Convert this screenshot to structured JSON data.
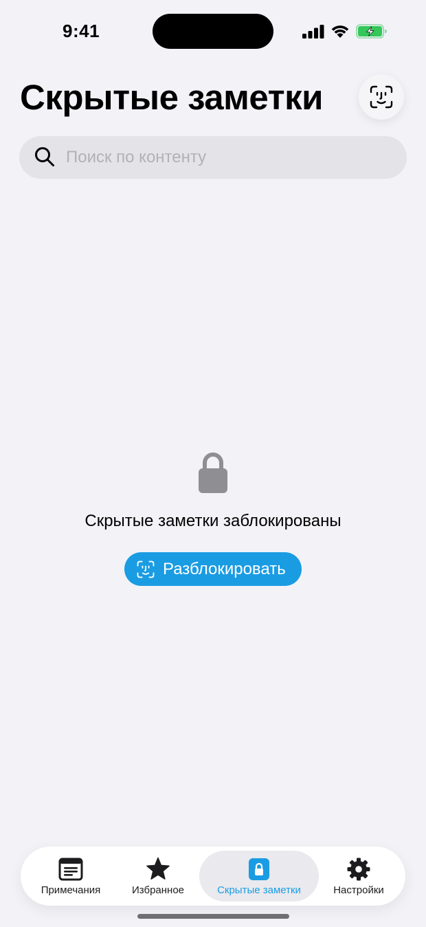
{
  "status_bar": {
    "time": "9:41"
  },
  "header": {
    "title": "Скрытые заметки"
  },
  "search": {
    "placeholder": "Поиск по контенту",
    "value": ""
  },
  "locked_state": {
    "message": "Скрытые заметки заблокированы",
    "unlock_label": "Разблокировать"
  },
  "tabs": [
    {
      "label": "Примечания",
      "icon": "notes-icon",
      "active": false
    },
    {
      "label": "Избранное",
      "icon": "star-icon",
      "active": false
    },
    {
      "label": "Скрытые заметки",
      "icon": "lock-icon",
      "active": true
    },
    {
      "label": "Настройки",
      "icon": "gear-icon",
      "active": false
    }
  ],
  "colors": {
    "accent": "#1a9ce3",
    "background": "#f2f2f7",
    "battery_fill": "#34c759",
    "lock_gray": "#8e8e93"
  }
}
